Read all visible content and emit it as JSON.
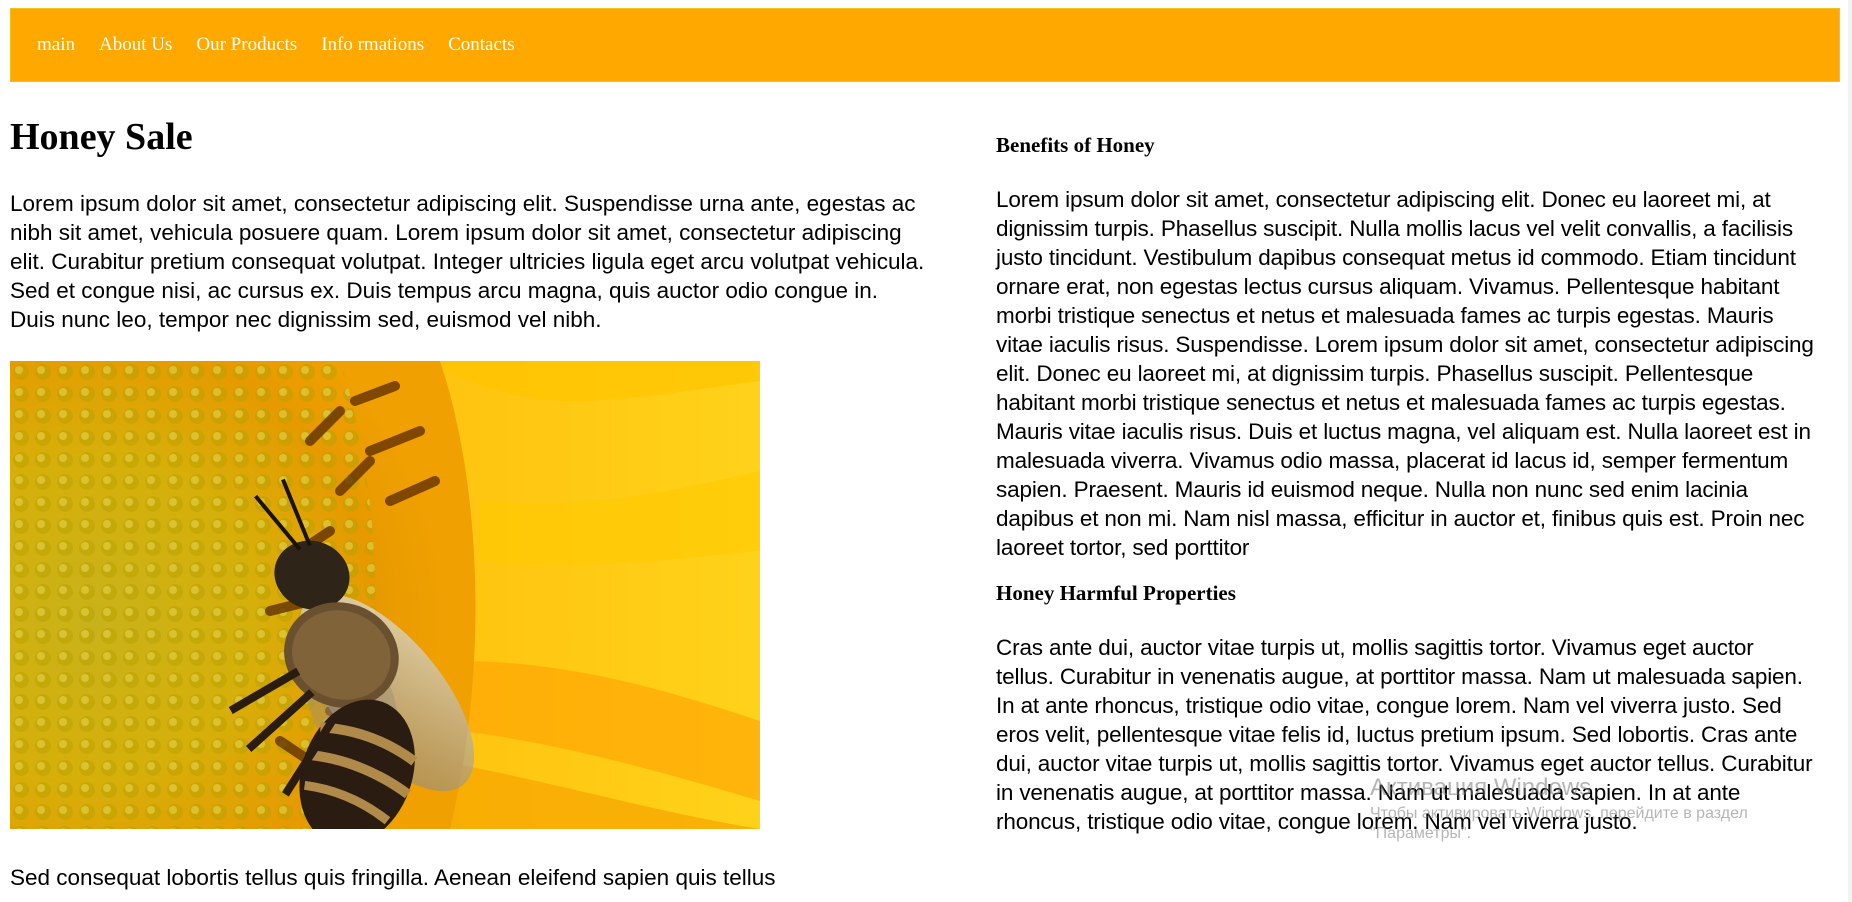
{
  "nav": {
    "items": [
      {
        "label": "main"
      },
      {
        "label": "About Us"
      },
      {
        "label": "Our Products"
      },
      {
        "label": "Info rmations"
      },
      {
        "label": "Contacts"
      }
    ],
    "background_color": "#ffa800"
  },
  "main": {
    "title": "Honey Sale",
    "intro": "Lorem ipsum dolor sit amet, consectetur adipiscing elit. Suspendisse urna ante, egestas ac nibh sit amet, vehicula posuere quam. Lorem ipsum dolor sit amet, consectetur adipiscing elit. Curabitur pretium consequat volutpat. Integer ultricies ligula eget arcu volutpat vehicula. Sed et congue nisi, ac cursus ex. Duis tempus arcu magna, quis auctor odio congue in. Duis nunc leo, tempor nec dignissim sed, euismod vel nibh.",
    "photo_description_icon": "bee-on-sunflower-image",
    "after_photo": "Sed consequat lobortis tellus quis fringilla. Aenean eleifend sapien quis tellus"
  },
  "aside": {
    "benefits": {
      "heading": "Benefits of Honey",
      "text": "Lorem ipsum dolor sit amet, consectetur adipiscing elit. Donec eu laoreet mi, at dignissim turpis. Phasellus suscipit. Nulla mollis lacus vel velit convallis, a facilisis justo tincidunt. Vestibulum dapibus consequat metus id commodo. Etiam tincidunt ornare erat, non egestas lectus cursus aliquam. Vivamus. Pellentesque habitant morbi tristique senectus et netus et malesuada fames ac turpis egestas. Mauris vitae iaculis risus. Suspendisse. Lorem ipsum dolor sit amet, consectetur adipiscing elit. Donec eu laoreet mi, at dignissim turpis. Phasellus suscipit. Pellentesque habitant morbi tristique senectus et netus et malesuada fames ac turpis egestas. Mauris vitae iaculis risus. Duis et luctus magna, vel aliquam est. Nulla laoreet est in malesuada viverra. Vivamus odio massa, placerat id lacus id, semper fermentum sapien. Praesent. Mauris id euismod neque. Nulla non nunc sed enim lacinia dapibus et non mi. Nam nisl massa, efficitur in auctor et, finibus quis est. Proin nec laoreet tortor, sed porttitor"
    },
    "harmful": {
      "heading": "Honey Harmful Properties",
      "text": "Cras ante dui, auctor vitae turpis ut, mollis sagittis tortor. Vivamus eget auctor tellus. Curabitur in venenatis augue, at porttitor massa. Nam ut malesuada sapien. In at ante rhoncus, tristique odio vitae, congue lorem. Nam vel viverra justo. Sed eros velit, pellentesque vitae felis id, luctus pretium ipsum. Sed lobortis. Cras ante dui, auctor vitae turpis ut, mollis sagittis tortor. Vivamus eget auctor tellus. Curabitur in venenatis augue, at porttitor massa. Nam ut malesuada sapien. In at ante rhoncus, tristique odio vitae, congue lorem. Nam vel viverra justo."
    }
  },
  "overlay": {
    "windows_activation_title": "Активация Windows",
    "windows_activation_hint": "Чтобы активировать Windows, перейдите в раздел \"Параметры\"."
  }
}
